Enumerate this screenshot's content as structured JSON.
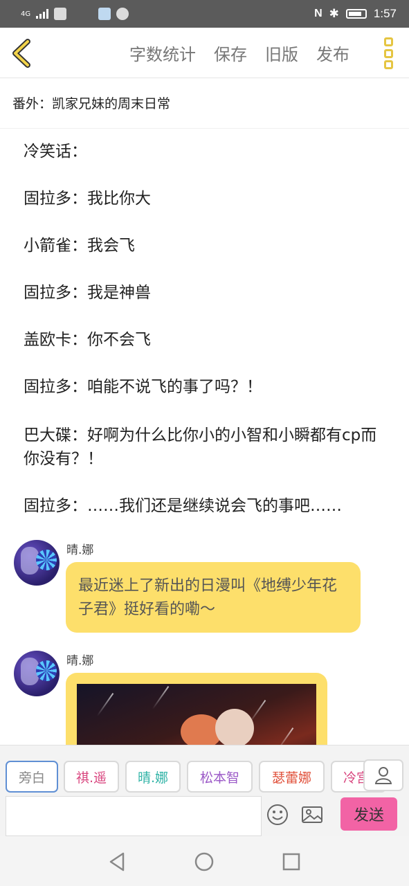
{
  "status_bar": {
    "signal_label": "4G",
    "time": "1:57"
  },
  "toolbar": {
    "back_icon": "chevron-left-icon",
    "items": [
      "字数统计",
      "保存",
      "旧版",
      "发布"
    ],
    "more_icon": "more-vertical-icon",
    "accent_color": "#e5c542"
  },
  "chapter_title": "番外：凯家兄妹的周末日常",
  "narration": [
    "冷笑话：",
    "固拉多：我比你大",
    "小箭雀：我会飞",
    "固拉多：我是神兽",
    "盖欧卡：你不会飞",
    "固拉多：咱能不说飞的事了吗？！",
    "巴大碟：好啊为什么比你小的小智和小瞬都有cp而你没有？！",
    "固拉多：……我们还是继续说会飞的事吧……"
  ],
  "messages": [
    {
      "sender": "晴.娜",
      "text": "最近迷上了新出的日漫叫《地缚少年花子君》挺好看的嘞～"
    },
    {
      "sender": "晴.娜",
      "type": "image"
    }
  ],
  "bubble_color": "#fddf6b",
  "characters": [
    {
      "label": "旁白",
      "color": "#888888"
    },
    {
      "label": "祺.遥",
      "color": "#d9467f"
    },
    {
      "label": "晴.娜",
      "color": "#2fb3a6"
    },
    {
      "label": "松本智",
      "color": "#9b59c7"
    },
    {
      "label": "瑟蕾娜",
      "color": "#e0503a"
    },
    {
      "label": "冷宫",
      "color": "#d9467f"
    }
  ],
  "input": {
    "placeholder": "",
    "send_label": "发送",
    "send_color": "#f263a5"
  }
}
